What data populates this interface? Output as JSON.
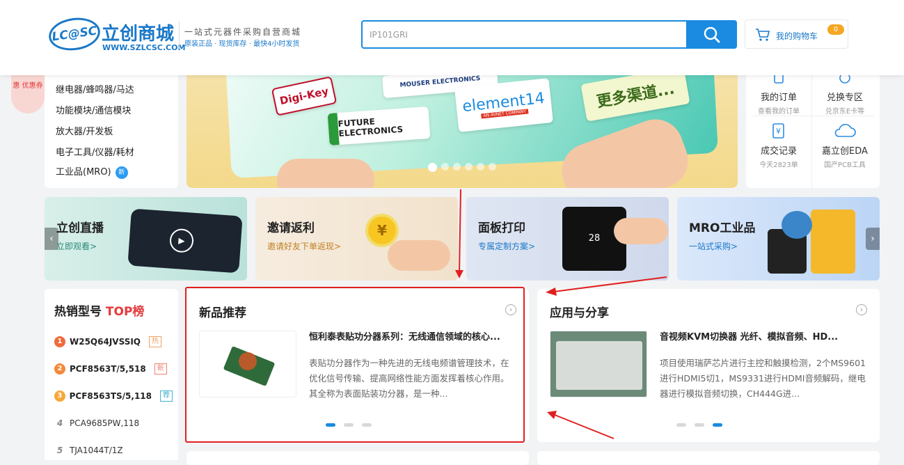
{
  "header": {
    "logo_badge": "LC@SC",
    "logo_name": "立创商城",
    "logo_url": "WWW.SZLCSC.COM",
    "slogan": "一站式元器件采购自营商城",
    "sub_slogan": "原装正品 · 现货库存 · 最快4小时发货",
    "search_value": "IP101GRI",
    "cart_label": "我的购物车",
    "cart_count": "0"
  },
  "left_badge": "惠 优惠券",
  "categories": [
    "继电器/蜂鸣器/马达",
    "功能模块/通信模块",
    "放大器/开发板",
    "电子工具/仪器/耗材",
    "工业品(MRO)"
  ],
  "new_tag": "新",
  "banner": {
    "brands": [
      "Digi-Key",
      "MOUSER ELECTRONICS",
      "element14",
      "FUTURE ELECTRONICS"
    ],
    "brand_sub": "AN AVNET COMPANY",
    "slogan": "更多渠道...",
    "active_dot": 0,
    "dot_count": 6
  },
  "quick_links": [
    {
      "title": "我的订单",
      "sub": "查看我的订单",
      "icon": "order-icon"
    },
    {
      "title": "兑换专区",
      "sub": "兑京东E卡等",
      "icon": "exchange-icon"
    },
    {
      "title": "成交记录",
      "sub": "今天2823单",
      "icon": "record-icon"
    },
    {
      "title": "嘉立创EDA",
      "sub": "国产PCB工具",
      "icon": "cloud-icon"
    }
  ],
  "promos": [
    {
      "title": "立创直播",
      "sub": "立即观看>",
      "sub_color": "#2a8a7a"
    },
    {
      "title": "邀请返利",
      "sub": "邀请好友下单返现>",
      "sub_color": "#c08020"
    },
    {
      "title": "面板打印",
      "sub": "专属定制方案>",
      "sub_color": "#1a78c8"
    },
    {
      "title": "MRO工业品",
      "sub": "一站式采购>",
      "sub_color": "#1a78c8"
    }
  ],
  "panel_screen_value": "28",
  "hot_list": {
    "title": "热销型号",
    "title_highlight": "TOP榜",
    "items": [
      {
        "rank": "1",
        "part": "W25Q64JVSSIQ",
        "tag": "热",
        "tag_color": "#f0a060"
      },
      {
        "rank": "2",
        "part": "PCF8563T/5,518",
        "tag": "新",
        "tag_color": "#f08070"
      },
      {
        "rank": "3",
        "part": "PCF8563TS/5,118",
        "tag": "荐",
        "tag_color": "#40b0d0"
      },
      {
        "rank": "4",
        "part": "PCA9685PW,118",
        "tag": ""
      },
      {
        "rank": "5",
        "part": "TJA1044T/1Z",
        "tag": ""
      }
    ]
  },
  "new_products": {
    "title": "新品推荐",
    "article_title": "恒利泰表贴功分器系列：无线通信领域的核心...",
    "article_desc": "表贴功分器作为一种先进的无线电频谱管理技术，在优化信号传输、提高网络性能方面发挥着核心作用。其全称为表面贴装功分器，是一种...",
    "active_page": 0
  },
  "share": {
    "title": "应用与分享",
    "article_title": "音视频KVM切换器 光纤、模拟音频、HD...",
    "article_desc": "项目使用瑞萨芯片进行主控和触摸检测，2个MS9601进行HDMI5切1，MS9331进行HDMI音频解码，继电器进行模拟音频切换，CH444G进...",
    "active_page": 2
  },
  "more_symbol": "›",
  "colors": {
    "brand_blue": "#1a78c8",
    "accent": "#1a8be0",
    "highlight_red": "#e02020"
  }
}
